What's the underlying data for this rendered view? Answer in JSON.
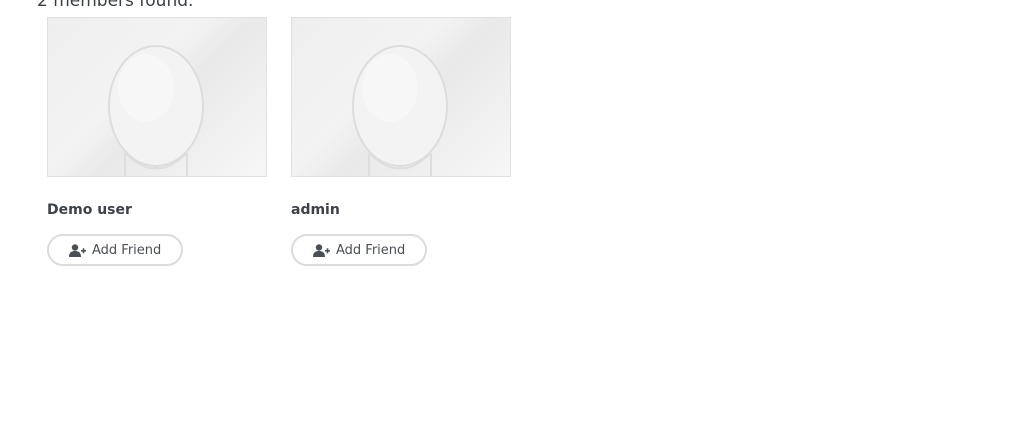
{
  "results": {
    "count_text": "2 members found."
  },
  "members": [
    {
      "name": "Demo user",
      "avatar_icon": "default-avatar-placeholder",
      "action_label": "Add Friend",
      "action_icon": "user-plus-icon"
    },
    {
      "name": "admin",
      "avatar_icon": "default-avatar-placeholder",
      "action_label": "Add Friend",
      "action_icon": "user-plus-icon"
    }
  ]
}
